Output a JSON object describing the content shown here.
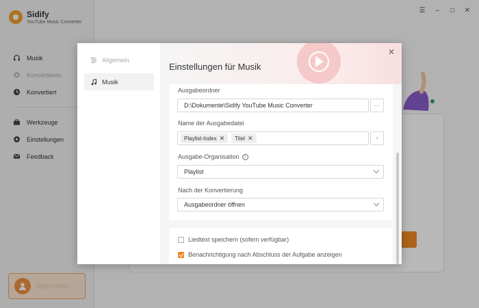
{
  "app": {
    "name": "Sidify",
    "subtitle": "YouTube Music Converter"
  },
  "window_controls": {
    "menu_glyph": "☰",
    "minimize_glyph": "–",
    "maximize_glyph": "□",
    "close_glyph": "✕"
  },
  "sidebar": {
    "items": [
      {
        "label": "Musik",
        "icon": "headphones-icon"
      },
      {
        "label": "Konvertieren",
        "icon": "convert-icon"
      },
      {
        "label": "Konvertiert",
        "icon": "clock-icon"
      },
      {
        "label": "Werkzeuge",
        "icon": "toolbox-icon"
      },
      {
        "label": "Einstellungen",
        "icon": "gear-icon"
      },
      {
        "label": "Feedback",
        "icon": "mail-icon"
      }
    ],
    "user_name": "Registrieren"
  },
  "dialog": {
    "title": "Einstellungen für Musik",
    "close_glyph": "✕",
    "tabs": [
      {
        "label": "Allgemein",
        "icon": "sliders-icon"
      },
      {
        "label": "Musik",
        "icon": "music-note-icon"
      }
    ],
    "output_folder": {
      "label": "Ausgabeordner",
      "value": "D:\\Dokumente\\Sidify YouTube Music Converter",
      "browse_label": "···"
    },
    "output_filename": {
      "label": "Name der Ausgabedatei",
      "tags": [
        "Playlist-Index",
        "Titel"
      ],
      "tag_remove_glyph": "✕",
      "add_label": "+"
    },
    "output_organisation": {
      "label": "Ausgabe-Organisation",
      "info_glyph": "i",
      "value": "Playlist"
    },
    "after_conversion": {
      "label": "Nach der Konvertierung",
      "value": "Ausgabeordner öffnen"
    },
    "checkboxes": [
      {
        "label": "Liedtext speichern (sofern verfügbar)",
        "checked": false
      },
      {
        "label": "Benachrichtigung nach Abschluss der Aufgabe anzeigen",
        "checked": true
      }
    ]
  },
  "colors": {
    "accent": "#f08a24",
    "header_tint": "#f8dede"
  }
}
